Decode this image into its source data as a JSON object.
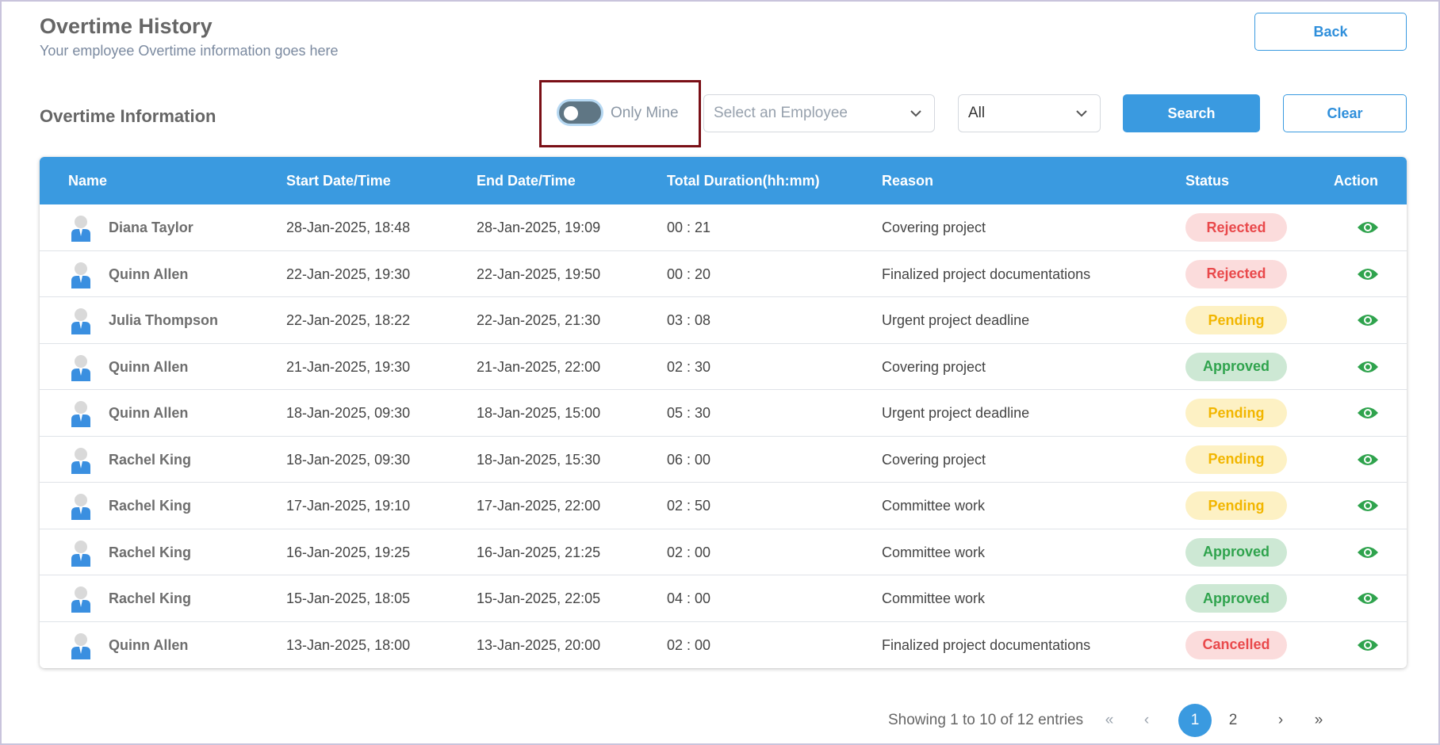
{
  "header": {
    "title": "Overtime History",
    "subtitle": "Your employee Overtime information goes here",
    "back_label": "Back"
  },
  "filters": {
    "section_title": "Overtime Information",
    "toggle_label": "Only Mine",
    "toggle_on": false,
    "employee_placeholder": "Select an Employee",
    "status_value": "All",
    "search_label": "Search",
    "clear_label": "Clear"
  },
  "table": {
    "columns": [
      "Name",
      "Start Date/Time",
      "End Date/Time",
      "Total Duration(hh:mm)",
      "Reason",
      "Status",
      "Action"
    ],
    "rows": [
      {
        "name": "Diana Taylor",
        "start": "28-Jan-2025, 18:48",
        "end": "28-Jan-2025, 19:09",
        "duration": "00 : 21",
        "reason": "Covering project",
        "status": "Rejected"
      },
      {
        "name": "Quinn Allen",
        "start": "22-Jan-2025, 19:30",
        "end": "22-Jan-2025, 19:50",
        "duration": "00 : 20",
        "reason": "Finalized project documentations",
        "status": "Rejected"
      },
      {
        "name": "Julia Thompson",
        "start": "22-Jan-2025, 18:22",
        "end": "22-Jan-2025, 21:30",
        "duration": "03 : 08",
        "reason": "Urgent project deadline",
        "status": "Pending"
      },
      {
        "name": "Quinn Allen",
        "start": "21-Jan-2025, 19:30",
        "end": "21-Jan-2025, 22:00",
        "duration": "02 : 30",
        "reason": "Covering project",
        "status": "Approved"
      },
      {
        "name": "Quinn Allen",
        "start": "18-Jan-2025, 09:30",
        "end": "18-Jan-2025, 15:00",
        "duration": "05 : 30",
        "reason": "Urgent project deadline",
        "status": "Pending"
      },
      {
        "name": "Rachel King",
        "start": "18-Jan-2025, 09:30",
        "end": "18-Jan-2025, 15:30",
        "duration": "06 : 00",
        "reason": "Covering project",
        "status": "Pending"
      },
      {
        "name": "Rachel King",
        "start": "17-Jan-2025, 19:10",
        "end": "17-Jan-2025, 22:00",
        "duration": "02 : 50",
        "reason": "Committee work",
        "status": "Pending"
      },
      {
        "name": "Rachel King",
        "start": "16-Jan-2025, 19:25",
        "end": "16-Jan-2025, 21:25",
        "duration": "02 : 00",
        "reason": "Committee work",
        "status": "Approved"
      },
      {
        "name": "Rachel King",
        "start": "15-Jan-2025, 18:05",
        "end": "15-Jan-2025, 22:05",
        "duration": "04 : 00",
        "reason": "Committee work",
        "status": "Approved"
      },
      {
        "name": "Quinn Allen",
        "start": "13-Jan-2025, 18:00",
        "end": "13-Jan-2025, 20:00",
        "duration": "02 : 00",
        "reason": "Finalized project documentations",
        "status": "Cancelled"
      }
    ]
  },
  "pagination": {
    "summary": "Showing 1 to 10 of 12 entries",
    "first": "«",
    "prev": "‹",
    "pages": [
      "1",
      "2"
    ],
    "current_page": "1",
    "next": "›",
    "last": "»"
  },
  "colors": {
    "accent": "#3a9ae0",
    "rejected": "#e9494b",
    "pending": "#f2b600",
    "approved": "#2fa34d",
    "highlight_border": "#7a0f16"
  },
  "icons": {
    "avatar": "user-avatar-icon",
    "action": "eye-icon",
    "dropdown": "chevron-down-icon"
  }
}
